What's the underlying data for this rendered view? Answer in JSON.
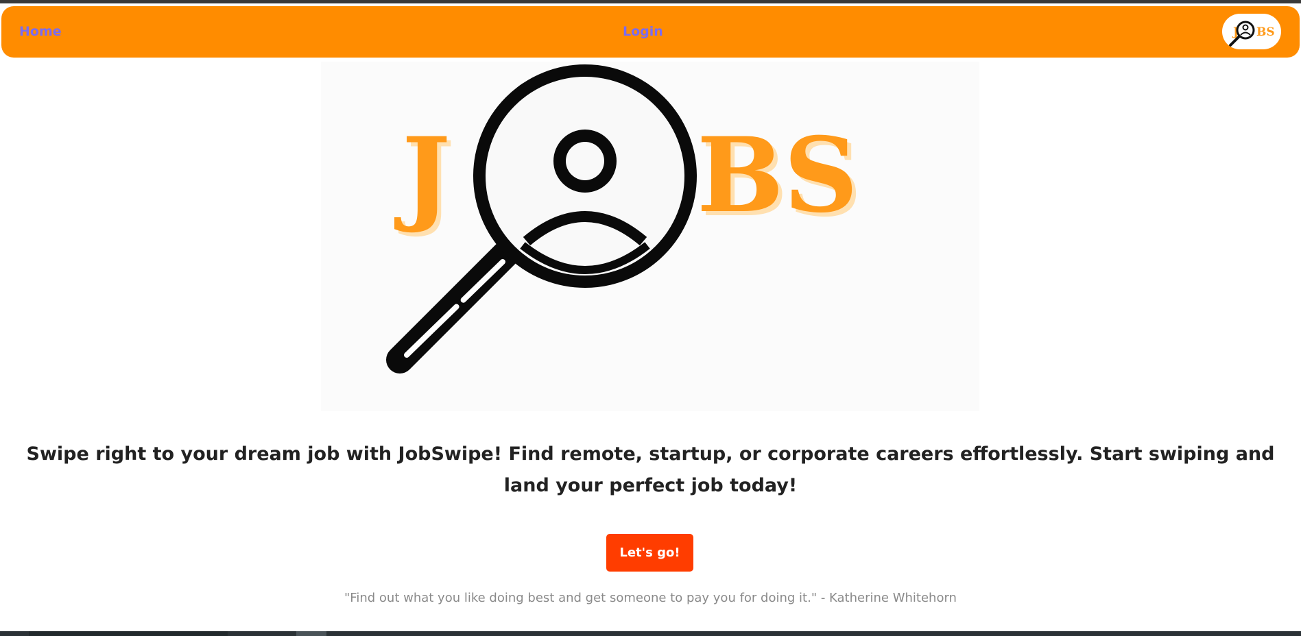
{
  "nav": {
    "home_label": "Home",
    "login_label": "Login"
  },
  "logo": {
    "text": "JOBS",
    "icon": "magnifier-person-icon"
  },
  "hero": {
    "tagline": "Swipe right to your dream job with JobSwipe! Find remote, startup, or corporate careers effortlessly. Start swiping and land your perfect job today!",
    "cta_label": "Let's go!",
    "quote": "\"Find out what you like doing best and get someone to pay you for doing it.\" - Katherine Whitehorn"
  },
  "colors": {
    "navbar": "#ff8c00",
    "nav_link": "#7b6cf0",
    "cta": "#ff3d00",
    "logo_letters": "#ff9a1a",
    "quote_text": "#8a8a8a"
  }
}
